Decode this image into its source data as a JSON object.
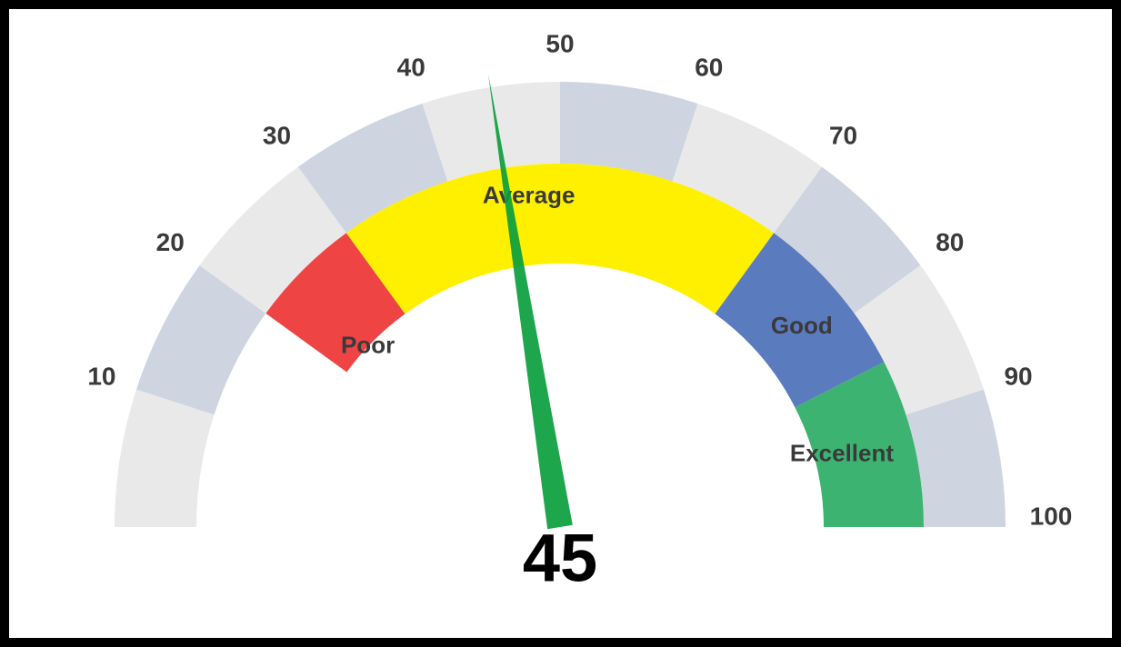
{
  "chart_data": {
    "type": "gauge",
    "min": 0,
    "max": 100,
    "value": 45,
    "ticks": [
      10,
      20,
      30,
      40,
      50,
      60,
      70,
      80,
      90,
      100
    ],
    "outer_band_colors": [
      "#e9e9e9",
      "#ced5e1"
    ],
    "zones": [
      {
        "name": "Poor",
        "from": 20,
        "to": 30,
        "color": "#ef4444"
      },
      {
        "name": "Average",
        "from": 30,
        "to": 70,
        "color": "#fff000"
      },
      {
        "name": "Good",
        "from": 70,
        "to": 85,
        "color": "#5b7bbf"
      },
      {
        "name": "Excellent",
        "from": 85,
        "to": 100,
        "color": "#3cb371"
      }
    ],
    "needle_color": "#0b9e3e"
  },
  "labels": {
    "value": "45",
    "ticks": {
      "t10": "10",
      "t20": "20",
      "t30": "30",
      "t40": "40",
      "t50": "50",
      "t60": "60",
      "t70": "70",
      "t80": "80",
      "t90": "90",
      "t100": "100"
    },
    "zones": {
      "poor": "Poor",
      "average": "Average",
      "good": "Good",
      "excellent": "Excellent"
    }
  }
}
